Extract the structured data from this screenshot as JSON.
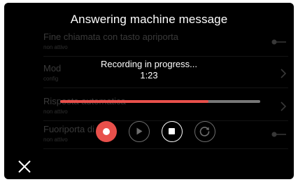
{
  "window": {
    "title": "Answering machine message"
  },
  "background_list": {
    "items": [
      {
        "title": "Fine chiamata con tasto apriporta",
        "subtitle": "non attivo",
        "control": "toggle-icon"
      },
      {
        "title": "Mod",
        "subtitle": "config",
        "control": "chevron-right-icon"
      },
      {
        "title": "Risposta automatica",
        "subtitle": "non attivo",
        "control": "chevron-right-icon"
      },
      {
        "title": "Fuoriporta di ... to",
        "subtitle": "non attivo",
        "control": "toggle-icon"
      }
    ]
  },
  "recording": {
    "status": "Recording in progress...",
    "elapsed": "1:23",
    "progress_fraction": 0.74
  },
  "controls": {
    "record_icon": "record-icon",
    "play_icon": "play-icon",
    "stop_icon": "stop-icon",
    "replay_icon": "replay-icon",
    "close_icon": "close-icon"
  },
  "colors": {
    "background": "#000000",
    "accent_record": "#e8504b",
    "track": "#777777",
    "text": "#ffffff",
    "disabled_control": "#6e6e6e"
  }
}
